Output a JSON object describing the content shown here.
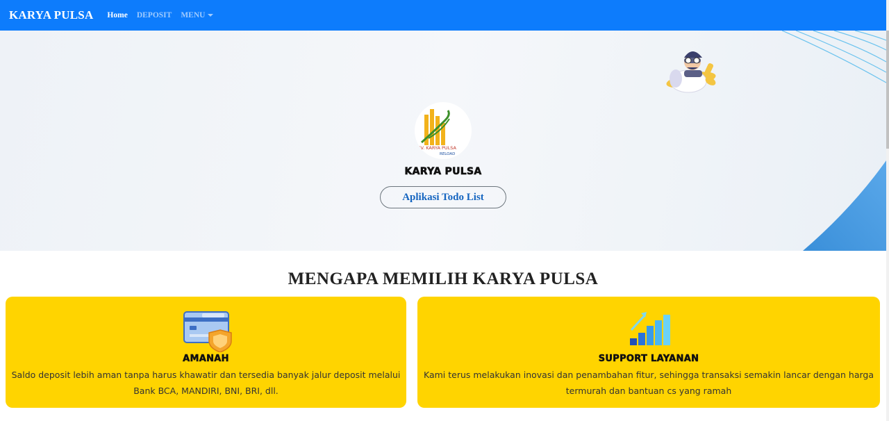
{
  "navbar": {
    "brand": "KARYA PULSA",
    "links": [
      {
        "label": "Home",
        "active": true
      },
      {
        "label": "DEPOSIT",
        "active": false
      },
      {
        "label": "MENU",
        "active": false
      }
    ],
    "color": "#0d7cfc"
  },
  "hero": {
    "logo_text_line1": "CV. KARYA PULSA",
    "logo_text_line2": "RELOAD",
    "title": "KARYA PULSA",
    "button_label": "Aplikasi Todo List"
  },
  "features": {
    "heading": "MENGAPA MEMILIH KARYA PULSA",
    "cards": [
      {
        "icon": "credit-card-shield-icon",
        "title": "AMANAH",
        "text": "Saldo deposit lebih aman tanpa harus khawatir dan tersedia banyak jalur deposit melalui Bank BCA, MANDIRI, BNI, BRI, dll."
      },
      {
        "icon": "growth-chart-icon",
        "title": "SUPPORT LAYANAN",
        "text": "Kami terus melakukan inovasi dan penambahan fitur, sehingga transaksi semakin lancar dengan harga termurah dan bantuan cs yang ramah"
      }
    ],
    "card_color": "#ffd400"
  }
}
